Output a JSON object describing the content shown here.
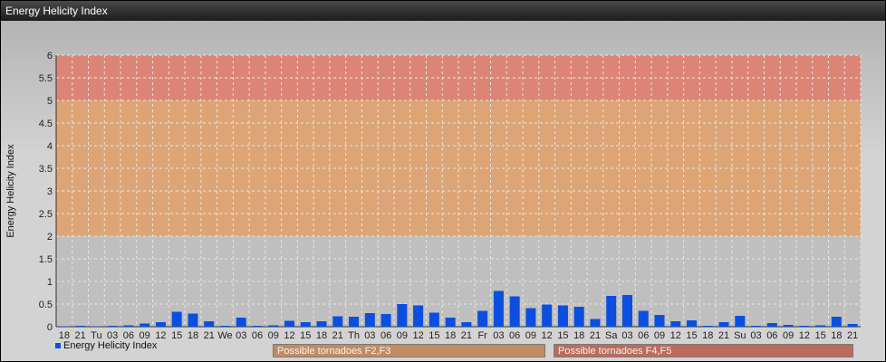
{
  "window": {
    "title": "Energy Helicity Index"
  },
  "legend": {
    "label": "Energy Helicity Index"
  },
  "zones": [
    {
      "label": "Possible tornadoes F2,F3",
      "from": 2,
      "to": 5,
      "color": "#e2a068"
    },
    {
      "label": "Possible tornadoes F4,F5",
      "from": 5,
      "to": 6,
      "color": "#e07a68"
    }
  ],
  "colors": {
    "bar": "#0a4fe0",
    "grid": "#e6e6e6",
    "axis": "#333333",
    "base_zone": "#bfbfbf"
  },
  "chart_data": {
    "type": "bar",
    "title": "",
    "xlabel": "",
    "ylabel": "Energy Helicity Index",
    "ylim": [
      0,
      6
    ],
    "yticks": [
      "0",
      "0.5",
      "1",
      "1.5",
      "2",
      "2.5",
      "3",
      "3.5",
      "4",
      "4.5",
      "5",
      "5.5",
      "6"
    ],
    "grid": true,
    "legend_position": "bottom-left",
    "categories": [
      "18",
      "21",
      "Tu",
      "03",
      "06",
      "09",
      "12",
      "15",
      "18",
      "21",
      "We",
      "03",
      "06",
      "09",
      "12",
      "15",
      "18",
      "21",
      "Th",
      "03",
      "06",
      "09",
      "12",
      "15",
      "18",
      "21",
      "Fr",
      "03",
      "06",
      "09",
      "12",
      "15",
      "18",
      "21",
      "Sa",
      "03",
      "06",
      "09",
      "12",
      "15",
      "18",
      "21",
      "Su",
      "03",
      "06",
      "09",
      "12",
      "15",
      "18",
      "21"
    ],
    "series": [
      {
        "name": "Energy Helicity Index",
        "values": [
          0.01,
          0.02,
          0.01,
          0.02,
          0.03,
          0.07,
          0.1,
          0.33,
          0.29,
          0.12,
          0.02,
          0.2,
          0.02,
          0.03,
          0.13,
          0.1,
          0.12,
          0.23,
          0.22,
          0.3,
          0.28,
          0.5,
          0.47,
          0.31,
          0.2,
          0.1,
          0.35,
          0.79,
          0.67,
          0.41,
          0.49,
          0.47,
          0.44,
          0.17,
          0.68,
          0.7,
          0.35,
          0.26,
          0.12,
          0.14,
          0.02,
          0.1,
          0.24,
          0.02,
          0.08,
          0.04,
          0.02,
          0.03,
          0.22,
          0.06
        ]
      }
    ]
  }
}
